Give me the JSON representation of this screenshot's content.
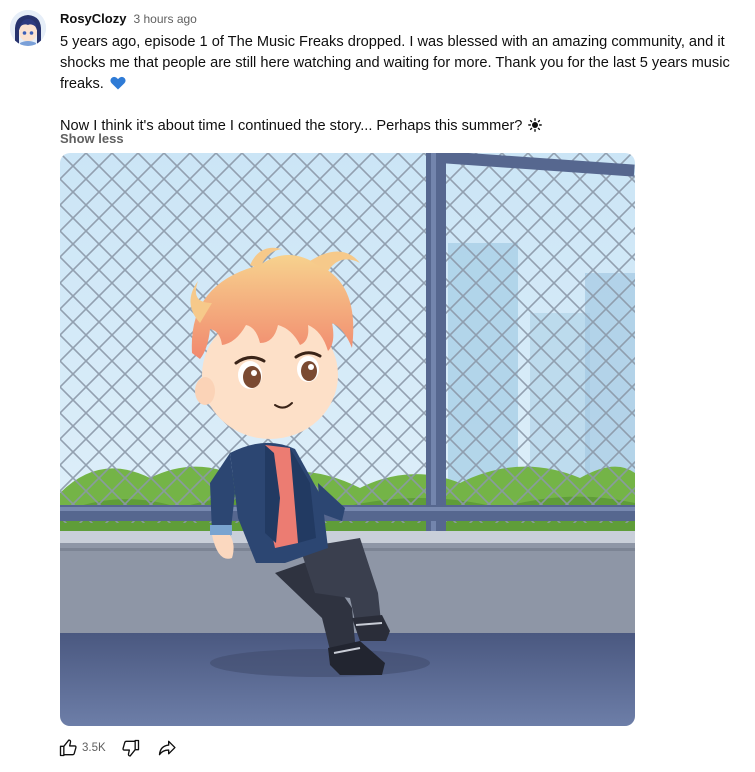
{
  "post": {
    "author": "RosyClozy",
    "timestamp": "3 hours ago",
    "paragraph1": "5 years ago, episode 1 of The Music Freaks dropped. I was blessed with an amazing community, and it shocks me that people are still here watching and waiting for more. Thank you for the last 5 years music freaks.",
    "heart_emoji": "blue-heart-icon",
    "paragraph2": "Now I think it's about time I continued the story... Perhaps this summer?",
    "sun_emoji": "sun-icon",
    "show_less_label": "Show less",
    "image_icon": "anime-character-illustration",
    "like_count": "3.5K"
  },
  "icons": {
    "like": "thumbs-up-icon",
    "dislike": "thumbs-down-icon",
    "share": "share-icon"
  },
  "colors": {
    "heart": "#2f7bd6",
    "secondary_text": "#606060",
    "primary_text": "#0f0f0f"
  }
}
